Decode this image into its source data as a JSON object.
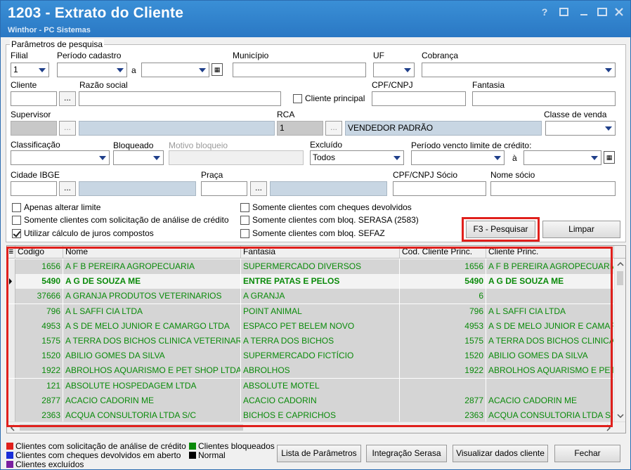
{
  "window": {
    "title": "1203 - Extrato do Cliente",
    "subtitle": "Winthor - PC Sistemas",
    "help_glyph": "?"
  },
  "params": {
    "group_title": "Parâmetros de pesquisa",
    "filial_label": "Filial",
    "filial_value": "1",
    "periodo_label": "Período cadastro",
    "a_label": "a",
    "municipio_label": "Município",
    "uf_label": "UF",
    "cobranca_label": "Cobrança",
    "cliente_label": "Cliente",
    "razao_label": "Razão social",
    "cliente_principal_label": "Cliente principal",
    "cpf_label": "CPF/CNPJ",
    "fantasia_label": "Fantasia",
    "supervisor_label": "Supervisor",
    "rca_label": "RCA",
    "rca_code": "1",
    "rca_name": "VENDEDOR PADRÃO",
    "classe_venda_label": "Classe de venda",
    "classificacao_label": "Classificação",
    "bloqueado_label": "Bloqueado",
    "motivo_label": "Motivo bloqueio",
    "excluido_label": "Excluído",
    "excluido_value": "Todos",
    "periodo_limite_label": "Período vencto limite de crédito:",
    "a2_label": "à",
    "cidade_ibge_label": "Cidade IBGE",
    "praca_label": "Praça",
    "cpf_socio_label": "CPF/CNPJ Sócio",
    "nome_socio_label": "Nome sócio",
    "dots": "...",
    "cal_glyph": "▦",
    "chk_apenas": "Apenas alterar limite",
    "chk_solicit": "Somente clientes com solicitação de análise de crédito",
    "chk_juros": "Utilizar cálculo de juros compostos",
    "chk_cheques": "Somente clientes com cheques devolvidos",
    "chk_serasa": "Somente clientes com bloq. SERASA (2583)",
    "chk_sefaz": "Somente clientes com bloq. SEFAZ"
  },
  "buttons": {
    "pesquisar": "F3 - Pesquisar",
    "limpar": "Limpar",
    "lista": "Lista de Parâmetros",
    "serasa": "Integração Serasa",
    "visualizar": "Visualizar dados cliente",
    "fechar": "Fechar"
  },
  "grid": {
    "headers": [
      "Codigo",
      "Nome",
      "Fantasia",
      "Cod. Cliente Princ.",
      "Cliente Princ."
    ],
    "rows": [
      {
        "codigo": "1656",
        "nome": "A F B PEREIRA AGROPECUARIA",
        "fantasia": "SUPERMERCADO DIVERSOS",
        "cod_princ": "1656",
        "cliente_princ": "A F B PEREIRA AGROPECUARIA"
      },
      {
        "codigo": "5490",
        "nome": "A G DE SOUZA ME",
        "fantasia": "ENTRE PATAS E PELOS",
        "cod_princ": "5490",
        "cliente_princ": "A G DE SOUZA ME"
      },
      {
        "codigo": "37666",
        "nome": "A GRANJA PRODUTOS VETERINARIOS",
        "fantasia": "A GRANJA",
        "cod_princ": "6",
        "cliente_princ": ""
      },
      {
        "codigo": "796",
        "nome": "A L SAFFI CIA LTDA",
        "fantasia": "POINT ANIMAL",
        "cod_princ": "796",
        "cliente_princ": "A L SAFFI CIA LTDA"
      },
      {
        "codigo": "4953",
        "nome": "A S DE MELO JUNIOR E CAMARGO LTDA",
        "fantasia": "ESPACO PET BELEM NOVO",
        "cod_princ": "4953",
        "cliente_princ": "A S DE MELO JUNIOR E CAMARGO"
      },
      {
        "codigo": "1575",
        "nome": "A TERRA DOS BICHOS CLINICA VETERINARIA",
        "fantasia": "A TERRA DOS BICHOS",
        "cod_princ": "1575",
        "cliente_princ": "A TERRA DOS BICHOS CLINICA VETERINARIA"
      },
      {
        "codigo": "1520",
        "nome": "ABILIO GOMES DA SILVA",
        "fantasia": "SUPERMERCADO FICTÍCIO",
        "cod_princ": "1520",
        "cliente_princ": "ABILIO GOMES DA SILVA"
      },
      {
        "codigo": "1922",
        "nome": "ABROLHOS AQUARISMO E PET SHOP LTDA",
        "fantasia": "ABROLHOS",
        "cod_princ": "1922",
        "cliente_princ": "ABROLHOS AQUARISMO E PET SHOP LTDA"
      },
      {
        "codigo": "121",
        "nome": "ABSOLUTE HOSPEDAGEM LTDA",
        "fantasia": "ABSOLUTE MOTEL",
        "cod_princ": "",
        "cliente_princ": ""
      },
      {
        "codigo": "2877",
        "nome": "ACACIO CADORIN ME",
        "fantasia": "ACACIO CADORIN",
        "cod_princ": "2877",
        "cliente_princ": "ACACIO CADORIN ME"
      },
      {
        "codigo": "2363",
        "nome": "ACQUA CONSULTORIA LTDA S/C",
        "fantasia": "BICHOS E CAPRICHOS",
        "cod_princ": "2363",
        "cliente_princ": "ACQUA CONSULTORIA LTDA S/C"
      }
    ]
  },
  "legend": {
    "solicit": "Clientes com solicitação de análise de crédito",
    "cheques": "Clientes com cheques devolvidos em aberto",
    "excluidos": "Clientes excluídos",
    "bloqueados": "Clientes bloqueados",
    "normal": "Normal"
  },
  "colors": {
    "title_bar": "#2a78c4",
    "row_green": "#0a8a0a",
    "highlight_red": "#e0201c",
    "legend_red": "#e0201c",
    "legend_blue": "#1a2fd8",
    "legend_purple": "#7a1fa0",
    "legend_green": "#0a8a0a",
    "legend_black": "#000000"
  }
}
